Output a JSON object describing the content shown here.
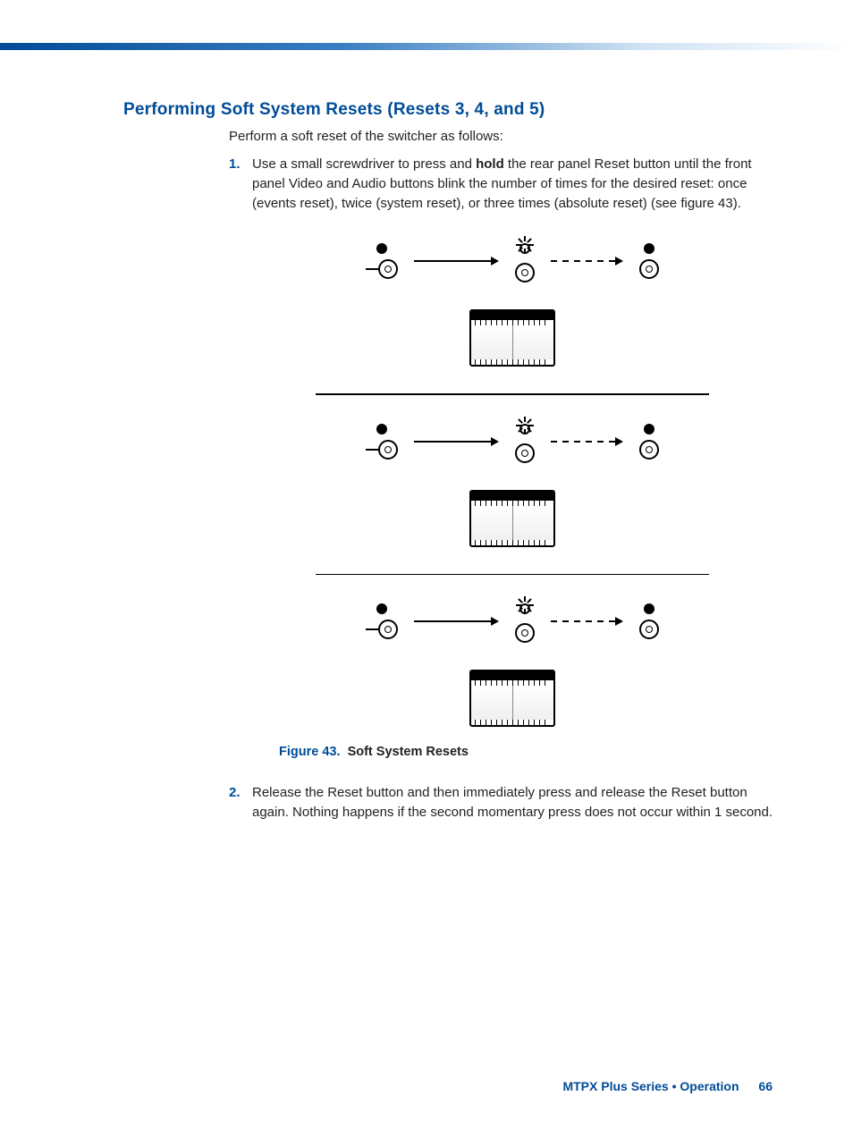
{
  "heading": "Performing Soft System Resets (Resets 3, 4, and 5)",
  "intro": "Perform a soft reset of the switcher as follows:",
  "step1_a": "Use a small screwdriver to press and ",
  "step1_bold": "hold",
  "step1_b": " the rear panel Reset button until the front panel Video and Audio buttons blink the number of times for the desired reset: once (events reset), twice (system reset), or three times (absolute reset) (see figure 43).",
  "figure_num": "Figure 43.",
  "figure_title": "Soft System Resets",
  "step2": "Release the Reset button and then immediately press and release the Reset button again. Nothing happens if the second momentary press does not occur within 1 second.",
  "footer_doc": "MTPX Plus Series • Operation",
  "footer_page": "66"
}
